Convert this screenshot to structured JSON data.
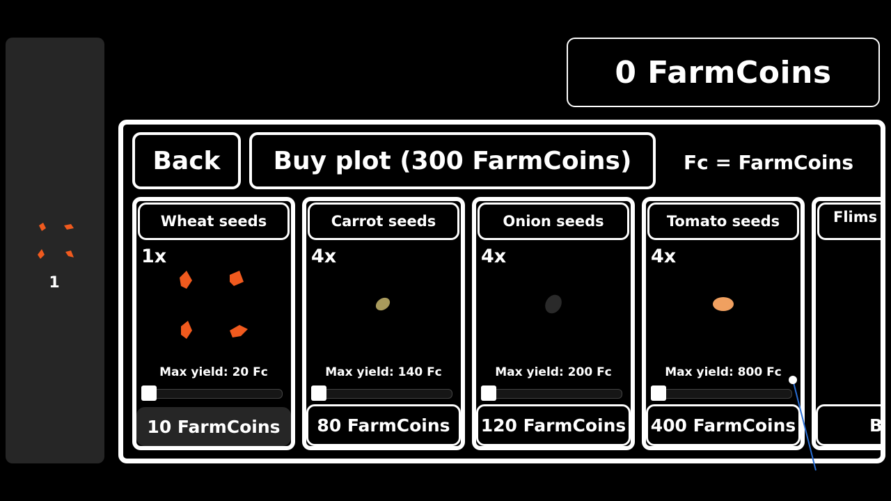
{
  "inventory": {
    "seed_icon": "wheat-seeds-icon",
    "count": "1"
  },
  "wallet": {
    "coins_label": "0 FarmCoins"
  },
  "shop": {
    "back_label": "Back",
    "buy_plot_label": "Buy plot (300 FarmCoins)",
    "legend": "Fc = FarmCoins",
    "cards": [
      {
        "title": "Wheat seeds",
        "qty": "1x",
        "max_yield": "Max yield: 20 Fc",
        "price": "10 FarmCoins",
        "icon": "wheat-seeds-icon",
        "slider_value": 0
      },
      {
        "title": "Carrot seeds",
        "qty": "4x",
        "max_yield": "Max yield: 140 Fc",
        "price": "80 FarmCoins",
        "icon": "carrot-seed-icon",
        "slider_value": 0
      },
      {
        "title": "Onion seeds",
        "qty": "4x",
        "max_yield": "Max yield: 200 Fc",
        "price": "120 FarmCoins",
        "icon": "onion-seed-icon",
        "slider_value": 0
      },
      {
        "title": "Tomato seeds",
        "qty": "4x",
        "max_yield": "Max yield: 800 Fc",
        "price": "400 FarmCoins",
        "icon": "tomato-seed-icon",
        "slider_value": 0
      },
      {
        "title": "Flims",
        "price": "B"
      }
    ]
  },
  "colors": {
    "wheat_seed": "#f05a1e",
    "carrot_seed": "#a89a5c",
    "onion_seed": "#2a2a2a",
    "tomato_seed": "#f0a060",
    "panel_gray": "#262626",
    "cursor_line": "#2a6fd6"
  }
}
